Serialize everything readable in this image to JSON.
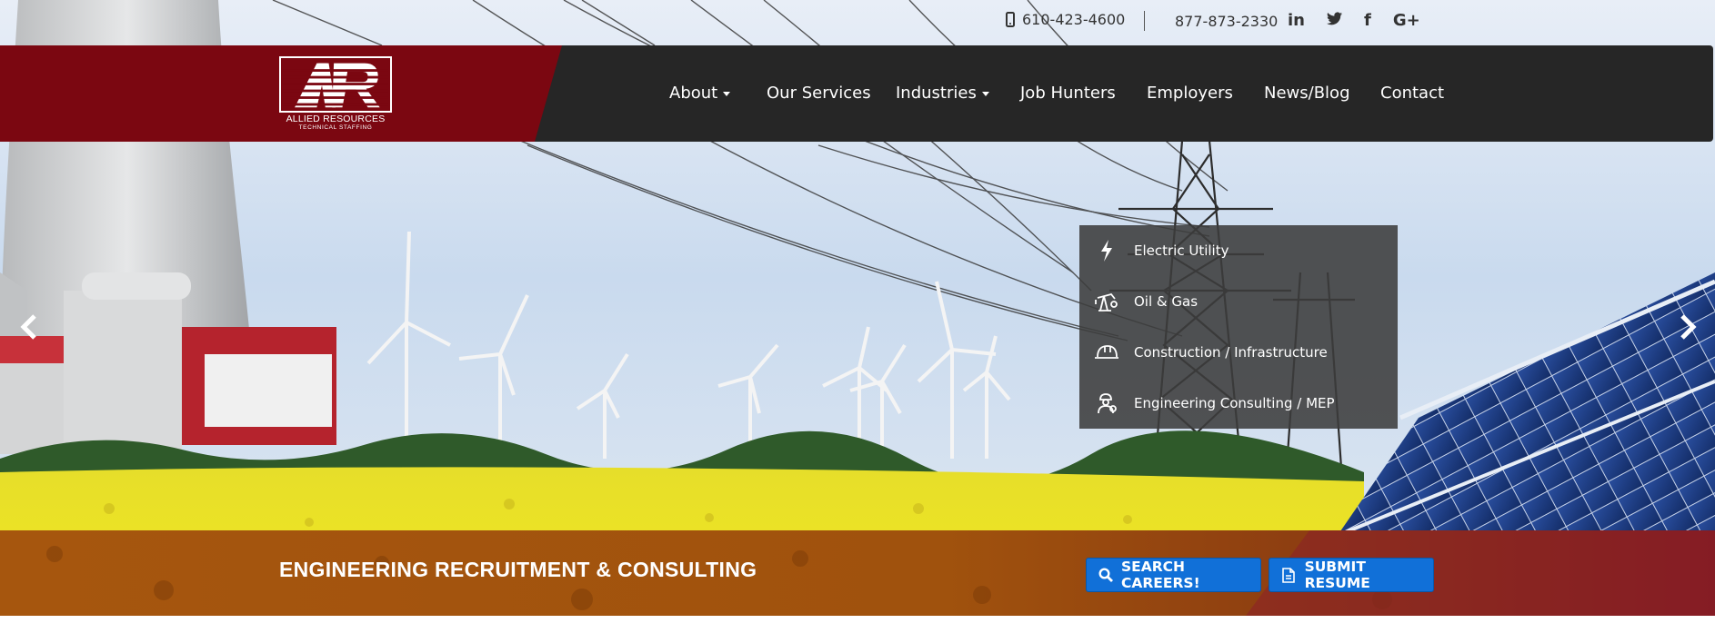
{
  "topbar": {
    "phone_icon": "mobile-phone-icon",
    "phone_primary": "610-423-4600",
    "phone_secondary": "877-873-2330",
    "social": [
      {
        "icon": "linkedin-icon",
        "glyph": "in"
      },
      {
        "icon": "twitter-icon",
        "glyph": "🐦"
      },
      {
        "icon": "facebook-icon",
        "glyph": "f"
      },
      {
        "icon": "google-plus-icon",
        "glyph": "G+"
      }
    ]
  },
  "logo": {
    "letters": "AR",
    "name": "ALLIED RESOURCES",
    "tagline": "TECHNICAL STAFFING"
  },
  "nav": {
    "about": "About",
    "services": "Our Services",
    "industries": "Industries",
    "job_hunters": "Job Hunters",
    "employers": "Employers",
    "news": "News/Blog",
    "contact": "Contact"
  },
  "dropdown": {
    "items": [
      {
        "label": "Electric Utility",
        "icon": "lightning-bolt-icon"
      },
      {
        "label": "Oil & Gas",
        "icon": "oil-pump-icon"
      },
      {
        "label": "Construction / Infrastructure",
        "icon": "hard-hat-icon"
      },
      {
        "label": "Engineering Consulting / MEP",
        "icon": "engineer-icon"
      }
    ]
  },
  "band": {
    "title": "ENGINEERING RECRUITMENT & CONSULTING",
    "search_label": "SEARCH CAREERS!",
    "resume_label": "SUBMIT RESUME"
  },
  "colors": {
    "brand_red": "#7b0711",
    "nav_dark": "#262626",
    "button_blue": "#1170d8",
    "band_orange": "#a85a10"
  }
}
